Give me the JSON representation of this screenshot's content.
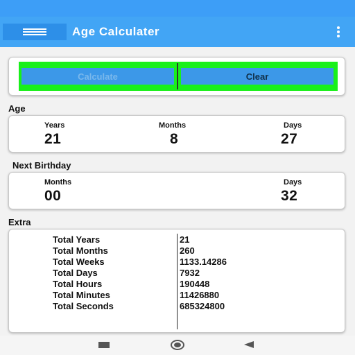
{
  "app_bar": {
    "title": "Age Calculater",
    "menu_icon": "hamburger-icon",
    "overflow_icon": "more-vert-icon",
    "color": "#42a5f5"
  },
  "actions": {
    "calculate_label": "Calculate",
    "clear_label": "Clear",
    "frame_color": "#19f01a",
    "button_color": "#3c98e8"
  },
  "age": {
    "section_label": "Age",
    "years_label": "Years",
    "months_label": "Months",
    "days_label": "Days",
    "years": "21",
    "months": "8",
    "days": "27"
  },
  "next_birthday": {
    "section_label": "Next Birthday",
    "months_label": "Months",
    "days_label": "Days",
    "months": "00",
    "days": "32"
  },
  "extra": {
    "section_label": "Extra",
    "rows": [
      {
        "label": "Total Years",
        "value": "21"
      },
      {
        "label": "Total Months",
        "value": "260"
      },
      {
        "label": "Total Weeks",
        "value": "1133.14286"
      },
      {
        "label": "Total Days",
        "value": "7932"
      },
      {
        "label": "Total Hours",
        "value": "190448"
      },
      {
        "label": "Total Minutes",
        "value": "11426880"
      },
      {
        "label": "Total Seconds",
        "value": "685324800"
      }
    ]
  },
  "nav": {
    "recents_icon": "square-recents-icon",
    "home_icon": "circle-home-icon",
    "back_icon": "triangle-back-icon"
  }
}
